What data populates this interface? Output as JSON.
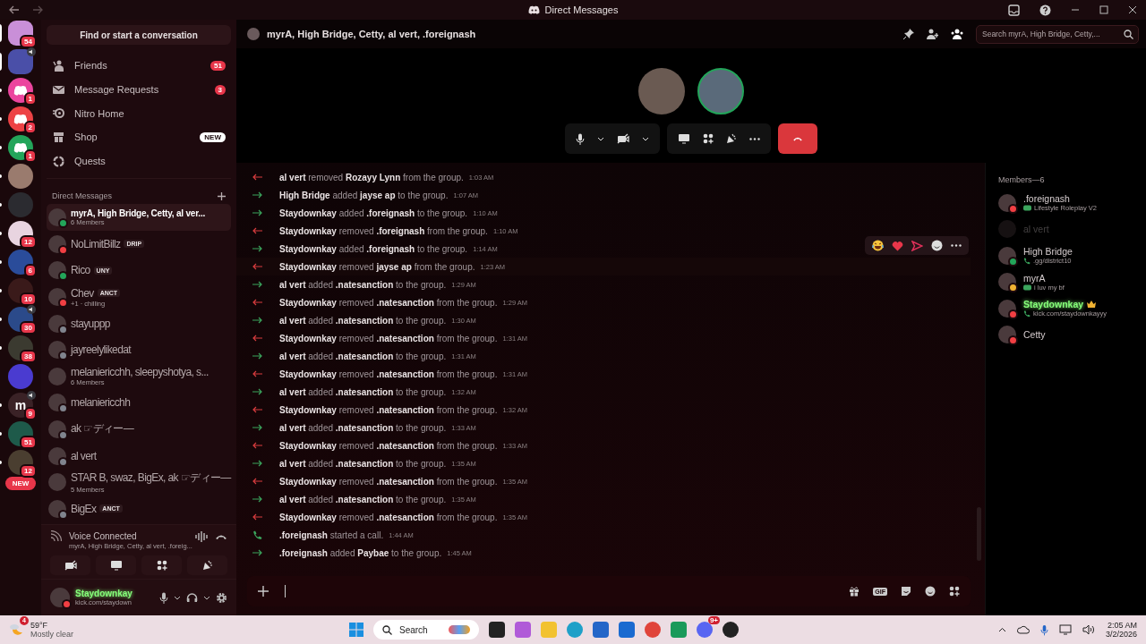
{
  "titlebar": {
    "title": "Direct Messages"
  },
  "servers": [
    {
      "kind": "photo",
      "color": "#c98fd8",
      "badge": "54",
      "selected": true
    },
    {
      "kind": "photo",
      "color": "#4a4fa8",
      "selected": true,
      "speaker": true
    },
    {
      "kind": "discord",
      "color": "#eb459e",
      "badge": "1",
      "selected": false,
      "unread": true
    },
    {
      "kind": "discord",
      "color": "#ed4245",
      "badge": "2",
      "selected": false,
      "unread": true
    },
    {
      "kind": "discord",
      "color": "#23a55a",
      "badge": "1",
      "selected": false,
      "unread": true
    },
    {
      "kind": "photo",
      "color": "#9a7b6e",
      "selected": false,
      "unread": true
    },
    {
      "kind": "photo",
      "color": "#2b2b30",
      "selected": false,
      "unread": true
    },
    {
      "kind": "photo",
      "color": "#e8d4e0",
      "badge": "12",
      "selected": false,
      "unread": true
    },
    {
      "kind": "photo",
      "color": "#2a4c9a",
      "badge": "6",
      "selected": false,
      "unread": true
    },
    {
      "kind": "photo",
      "color": "#3a1a1a",
      "badge": "10",
      "selected": false,
      "unread": true
    },
    {
      "kind": "photo",
      "color": "#2b4a8a",
      "badge": "30",
      "selected": false,
      "unread": true,
      "speaker": true
    },
    {
      "kind": "photo",
      "color": "#3b3a30",
      "badge": "38",
      "selected": false,
      "unread": true
    },
    {
      "kind": "photo",
      "color": "#4a3bd0",
      "selected": false
    },
    {
      "kind": "letter",
      "label": "m",
      "color": "#3a2226",
      "badge": "9",
      "selected": false,
      "unread": true,
      "speaker": true
    },
    {
      "kind": "photo",
      "color": "#1e5a4a",
      "badge": "51",
      "selected": false,
      "unread": true
    },
    {
      "kind": "photo",
      "color": "#4a3e30",
      "badge": "12",
      "selected": false,
      "unread": true
    }
  ],
  "new_label": "NEW",
  "sidebar": {
    "search": "Find or start a conversation",
    "nav": [
      {
        "kind": "friends",
        "label": "Friends",
        "badge": "51"
      },
      {
        "kind": "requests",
        "label": "Message Requests",
        "badge": "3"
      },
      {
        "kind": "nitro",
        "label": "Nitro Home"
      },
      {
        "kind": "shop",
        "label": "Shop",
        "tag": "NEW"
      },
      {
        "kind": "quests",
        "label": "Quests"
      }
    ],
    "dm_header": "Direct Messages",
    "dms": [
      {
        "name": "myrA, High Bridge, Cetty, al ver...",
        "members": "6 Members",
        "selected": true,
        "color": "#23a55a"
      },
      {
        "name": "NoLimitBillz",
        "tag": "DRIP",
        "selected": false,
        "color": "#f23f43"
      },
      {
        "name": "Rico",
        "tag": "UNY",
        "selected": false,
        "color": "#23a55a"
      },
      {
        "name": "Chev",
        "tag": "ANCT",
        "activity": "+1 · chilling",
        "selected": false,
        "color": "#f23f43"
      },
      {
        "name": "stayuppp",
        "selected": false,
        "color": "#80848e"
      },
      {
        "name": "jayreelylikedat",
        "selected": false,
        "color": "#80848e"
      },
      {
        "name": "melaniericchh, sleepyshotya, s...",
        "members": "6 Members",
        "selected": false
      },
      {
        "name": "melaniericchh",
        "selected": false,
        "color": "#80848e"
      },
      {
        "name": "ak ☞ディー—",
        "selected": false,
        "color": "#80848e"
      },
      {
        "name": "al vert",
        "selected": false,
        "color": "#80848e"
      },
      {
        "name": "STAR B, swaz, BigEx, ak ☞ディー—",
        "members": "5 Members",
        "selected": false
      },
      {
        "name": "BigEx",
        "tag": "ANCT",
        "selected": false,
        "color": "#80848e"
      }
    ],
    "voice": {
      "title": "Voice Connected",
      "channel": "myrA, High Bridge, Cetty, al vert, .foreig..."
    },
    "user": {
      "name": "Staydownkay",
      "activity": "kick.com/staydown",
      "color": "#f23f43"
    }
  },
  "header": {
    "title": "myrA, High Bridge, Cetty, al vert, .foreignash",
    "search_placeholder": "Search myrA, High Bridge, Cetty,..."
  },
  "call": {
    "participants": [
      {
        "speaking": false,
        "color": "#6a5a52"
      },
      {
        "speaking": true,
        "color": "#5a6a7a"
      }
    ]
  },
  "messages": [
    {
      "kind": "leave",
      "actor": "al vert",
      "action": "removed",
      "target": "Rozayy Lynn",
      "rest": "from the group.",
      "time": "1:03 AM",
      "hovered": false
    },
    {
      "kind": "join",
      "actor": "High Bridge",
      "action": "added",
      "target": "jayse ap",
      "rest": "to the group.",
      "time": "1:07 AM",
      "hovered": false
    },
    {
      "kind": "join",
      "actor": "Staydownkay",
      "action": "added",
      "target": ".foreignash",
      "rest": "to the group.",
      "time": "1:10 AM",
      "hovered": false
    },
    {
      "kind": "leave",
      "actor": "Staydownkay",
      "action": "removed",
      "target": ".foreignash",
      "rest": "from the group.",
      "time": "1:10 AM",
      "hovered": false
    },
    {
      "kind": "join",
      "actor": "Staydownkay",
      "action": "added",
      "target": ".foreignash",
      "rest": "to the group.",
      "time": "1:14 AM",
      "hovered": false
    },
    {
      "kind": "leave",
      "actor": "Staydownkay",
      "action": "removed",
      "target": "jayse ap",
      "rest": "from the group.",
      "time": "1:23 AM",
      "hovered": true
    },
    {
      "kind": "join",
      "actor": "al vert",
      "action": "added",
      "target": ".natesanction",
      "rest": "to the group.",
      "time": "1:29 AM",
      "hovered": false
    },
    {
      "kind": "leave",
      "actor": "Staydownkay",
      "action": "removed",
      "target": ".natesanction",
      "rest": "from the group.",
      "time": "1:29 AM",
      "hovered": false
    },
    {
      "kind": "join",
      "actor": "al vert",
      "action": "added",
      "target": ".natesanction",
      "rest": "to the group.",
      "time": "1:30 AM",
      "hovered": false
    },
    {
      "kind": "leave",
      "actor": "Staydownkay",
      "action": "removed",
      "target": ".natesanction",
      "rest": "from the group.",
      "time": "1:31 AM",
      "hovered": false
    },
    {
      "kind": "join",
      "actor": "al vert",
      "action": "added",
      "target": ".natesanction",
      "rest": "to the group.",
      "time": "1:31 AM",
      "hovered": false
    },
    {
      "kind": "leave",
      "actor": "Staydownkay",
      "action": "removed",
      "target": ".natesanction",
      "rest": "from the group.",
      "time": "1:31 AM",
      "hovered": false
    },
    {
      "kind": "join",
      "actor": "al vert",
      "action": "added",
      "target": ".natesanction",
      "rest": "to the group.",
      "time": "1:32 AM",
      "hovered": false
    },
    {
      "kind": "leave",
      "actor": "Staydownkay",
      "action": "removed",
      "target": ".natesanction",
      "rest": "from the group.",
      "time": "1:32 AM",
      "hovered": false
    },
    {
      "kind": "join",
      "actor": "al vert",
      "action": "added",
      "target": ".natesanction",
      "rest": "to the group.",
      "time": "1:33 AM",
      "hovered": false
    },
    {
      "kind": "leave",
      "actor": "Staydownkay",
      "action": "removed",
      "target": ".natesanction",
      "rest": "from the group.",
      "time": "1:33 AM",
      "hovered": false
    },
    {
      "kind": "join",
      "actor": "al vert",
      "action": "added",
      "target": ".natesanction",
      "rest": "to the group.",
      "time": "1:35 AM",
      "hovered": false
    },
    {
      "kind": "leave",
      "actor": "Staydownkay",
      "action": "removed",
      "target": ".natesanction",
      "rest": "from the group.",
      "time": "1:35 AM",
      "hovered": false
    },
    {
      "kind": "join",
      "actor": "al vert",
      "action": "added",
      "target": ".natesanction",
      "rest": "to the group.",
      "time": "1:35 AM",
      "hovered": false
    },
    {
      "kind": "leave",
      "actor": "Staydownkay",
      "action": "removed",
      "target": ".natesanction",
      "rest": "from the group.",
      "time": "1:35 AM",
      "hovered": false
    },
    {
      "kind": "call",
      "actor": ".foreignash",
      "action": "started a call.",
      "time": "1:44 AM",
      "hovered": false
    },
    {
      "kind": "join",
      "actor": ".foreignash",
      "action": "added",
      "target": "Paybae",
      "rest": "to the group.",
      "time": "1:45 AM",
      "hovered": false
    }
  ],
  "composer": {
    "gif_label": "GIF"
  },
  "members": {
    "heading": "Members—6",
    "list": [
      {
        "kind": "game",
        "name": ".foreignash",
        "activity": "Lifestyle Roleplay V2",
        "color": "#f23f43",
        "offline": false,
        "owner": false,
        "highlighted": false
      },
      {
        "kind": "plain",
        "name": "al vert",
        "offline": true,
        "owner": false,
        "highlighted": false
      },
      {
        "kind": "call",
        "name": "High Bridge",
        "activity": ".gg/district10",
        "color": "#23a55a",
        "offline": false,
        "owner": false,
        "highlighted": false
      },
      {
        "kind": "game",
        "name": "myrA",
        "activity": "i luv my bf",
        "color": "#f0b232",
        "offline": false,
        "owner": false,
        "highlighted": false
      },
      {
        "kind": "call",
        "name": "Staydownkay",
        "activity": "kick.com/staydownkayyy",
        "color": "#f23f43",
        "offline": false,
        "owner": true,
        "highlighted": true
      },
      {
        "kind": "plain",
        "name": "Cetty",
        "color": "#f23f43",
        "offline": false,
        "owner": false,
        "highlighted": false
      }
    ]
  },
  "taskbar": {
    "weather_badge": "4",
    "temperature": "59°F",
    "condition": "Mostly clear",
    "search": "Search",
    "apps_badge": "9+",
    "time": "2:05 AM",
    "date": "3/2/2026"
  }
}
